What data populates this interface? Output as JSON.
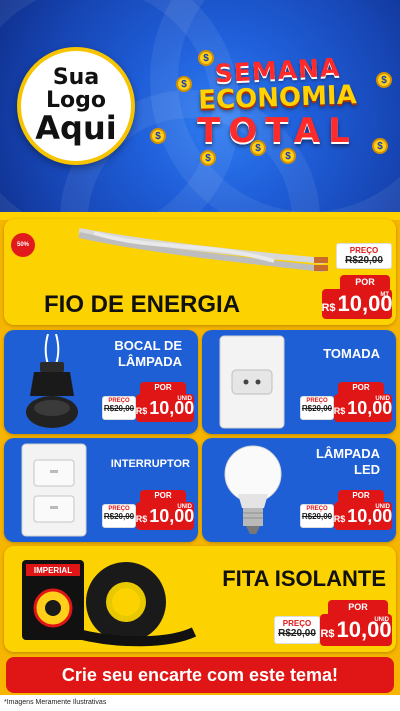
{
  "header": {
    "logo_line1": "Sua Logo",
    "logo_line2": "Aqui",
    "title_line1": "SEMANA",
    "title_line2": "ECONOMIA",
    "title_line3": "TOTAL",
    "coin_symbol": "$"
  },
  "products": {
    "fio": {
      "name": "FIO DE ENERGIA",
      "badge": "50%",
      "preco_label": "PREÇO",
      "old_price": "R$20,00",
      "por_label": "POR",
      "currency": "R$",
      "price": "10,00",
      "unit": "MT"
    },
    "bocal": {
      "name_line1": "BOCAL DE",
      "name_line2": "LÂMPADA",
      "preco_label": "PREÇO",
      "old_price": "R$20,00",
      "por_label": "POR",
      "currency": "R$",
      "price": "10,00",
      "unit": "UNID"
    },
    "tomada": {
      "name": "TOMADA",
      "preco_label": "PREÇO",
      "old_price": "R$20,00",
      "por_label": "POR",
      "currency": "R$",
      "price": "10,00",
      "unit": "UNID"
    },
    "interruptor": {
      "name": "INTERRUPTOR",
      "preco_label": "PREÇO",
      "old_price": "R$20,00",
      "por_label": "POR",
      "currency": "R$",
      "price": "10,00",
      "unit": "UNID"
    },
    "lampada": {
      "name_line1": "LÂMPADA",
      "name_line2": "LED",
      "preco_label": "PREÇO",
      "old_price": "R$20,00",
      "por_label": "POR",
      "currency": "R$",
      "price": "10,00",
      "unit": "UNID"
    },
    "fita": {
      "name": "FITA ISOLANTE",
      "brand": "IMPERIAL",
      "preco_label": "PREÇO",
      "old_price": "R$20,00",
      "por_label": "POR",
      "currency": "R$",
      "price": "10,00",
      "unit": "UNID"
    }
  },
  "cta": "Crie seu encarte com este tema!",
  "disclaimer": "*Imagens Meramente Ilustrativas",
  "colors": {
    "blue": "#1f5fd6",
    "yellow": "#fcd200",
    "red": "#e01616"
  }
}
